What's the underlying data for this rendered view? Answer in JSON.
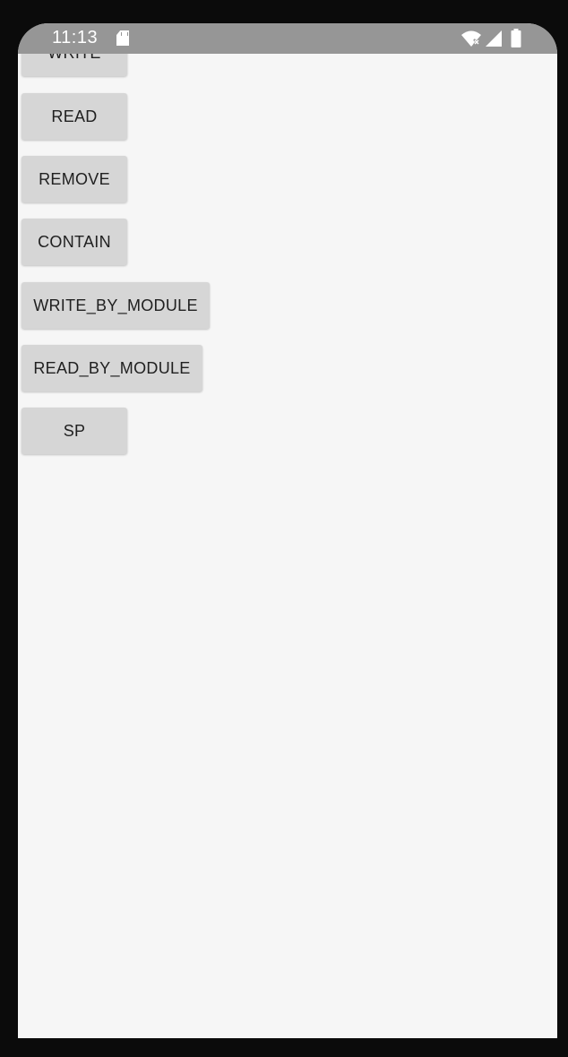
{
  "status_bar": {
    "time": "11:13",
    "icons": [
      "sd-card-icon",
      "wifi-icon",
      "signal-icon",
      "battery-icon"
    ],
    "background": "#969696"
  },
  "screen": {
    "background": "#f6f6f6"
  },
  "buttons": [
    {
      "label": "WRITE"
    },
    {
      "label": "READ"
    },
    {
      "label": "REMOVE"
    },
    {
      "label": "CONTAIN"
    },
    {
      "label": "WRITE_BY_MODULE"
    },
    {
      "label": "READ_BY_MODULE"
    },
    {
      "label": "SP"
    }
  ],
  "colors": {
    "button_bg": "#d6d6d6",
    "button_text": "#202020"
  }
}
